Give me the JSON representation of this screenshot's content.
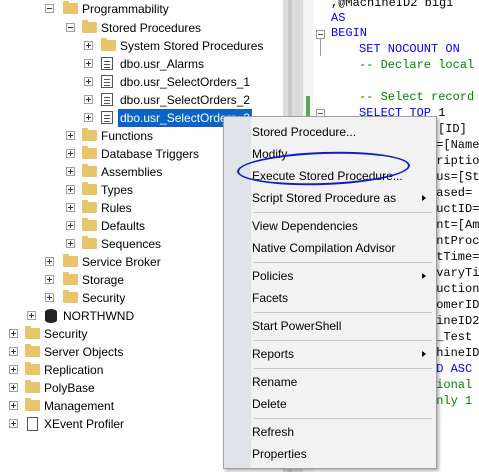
{
  "tree": {
    "programmability": "Programmability",
    "stored_procedures": "Stored Procedures",
    "system_stored_procedures": "System Stored Procedures",
    "sp_alarms": "dbo.usr_Alarms",
    "sp_select_orders_1": "dbo.usr_SelectOrders_1",
    "sp_select_orders_2": "dbo.usr_SelectOrders_2",
    "sp_select_orders_3": "dbo.usr_SelectOrders_3",
    "functions": "Functions",
    "database_triggers": "Database Triggers",
    "assemblies": "Assemblies",
    "types": "Types",
    "rules": "Rules",
    "defaults": "Defaults",
    "sequences": "Sequences",
    "service_broker": "Service Broker",
    "storage": "Storage",
    "security_db": "Security",
    "northwnd": "NORTHWND",
    "security": "Security",
    "server_objects": "Server Objects",
    "replication": "Replication",
    "polybase": "PolyBase",
    "management": "Management",
    "xevent_profiler": "XEvent Profiler"
  },
  "editor": {
    "l1_a": ",@MachineID2 bigi",
    "l2": "AS",
    "l3": "BEGIN",
    "l4_kw": "SET NOCOUNT ON",
    "l5": "-- Declare local p",
    "l6": "-- Select record w",
    "l7_kw": "SELECT TOP",
    "l7_num": " 1",
    "frag1": "[ID]",
    "frag2": "e=[Name",
    "frag3": "cription",
    "frag4": "tus=[St",
    "frag5": "eased=",
    "frag6": "ductID=",
    "frag7": "unt=[Am",
    "frag8": "untProc",
    "frag9": "rtTime=",
    "frag10": "ivaryTi",
    "frag11": "duction",
    "frag12": "tomerID",
    "frag13": "hineID2",
    "frag14": "W_Test",
    "frag15": "chineID",
    "frag16": "ID ASC",
    "frag17": "tional",
    "frag18": "Only 1"
  },
  "menu": {
    "stored_procedure": "Stored Procedure...",
    "modify": "Modify",
    "execute": "Execute Stored Procedure...",
    "script_as": "Script Stored Procedure as",
    "view_dependencies": "View Dependencies",
    "native_compilation": "Native Compilation Advisor",
    "policies": "Policies",
    "facets": "Facets",
    "start_powershell": "Start PowerShell",
    "reports": "Reports",
    "rename": "Rename",
    "delete": "Delete",
    "refresh": "Refresh",
    "properties": "Properties"
  }
}
